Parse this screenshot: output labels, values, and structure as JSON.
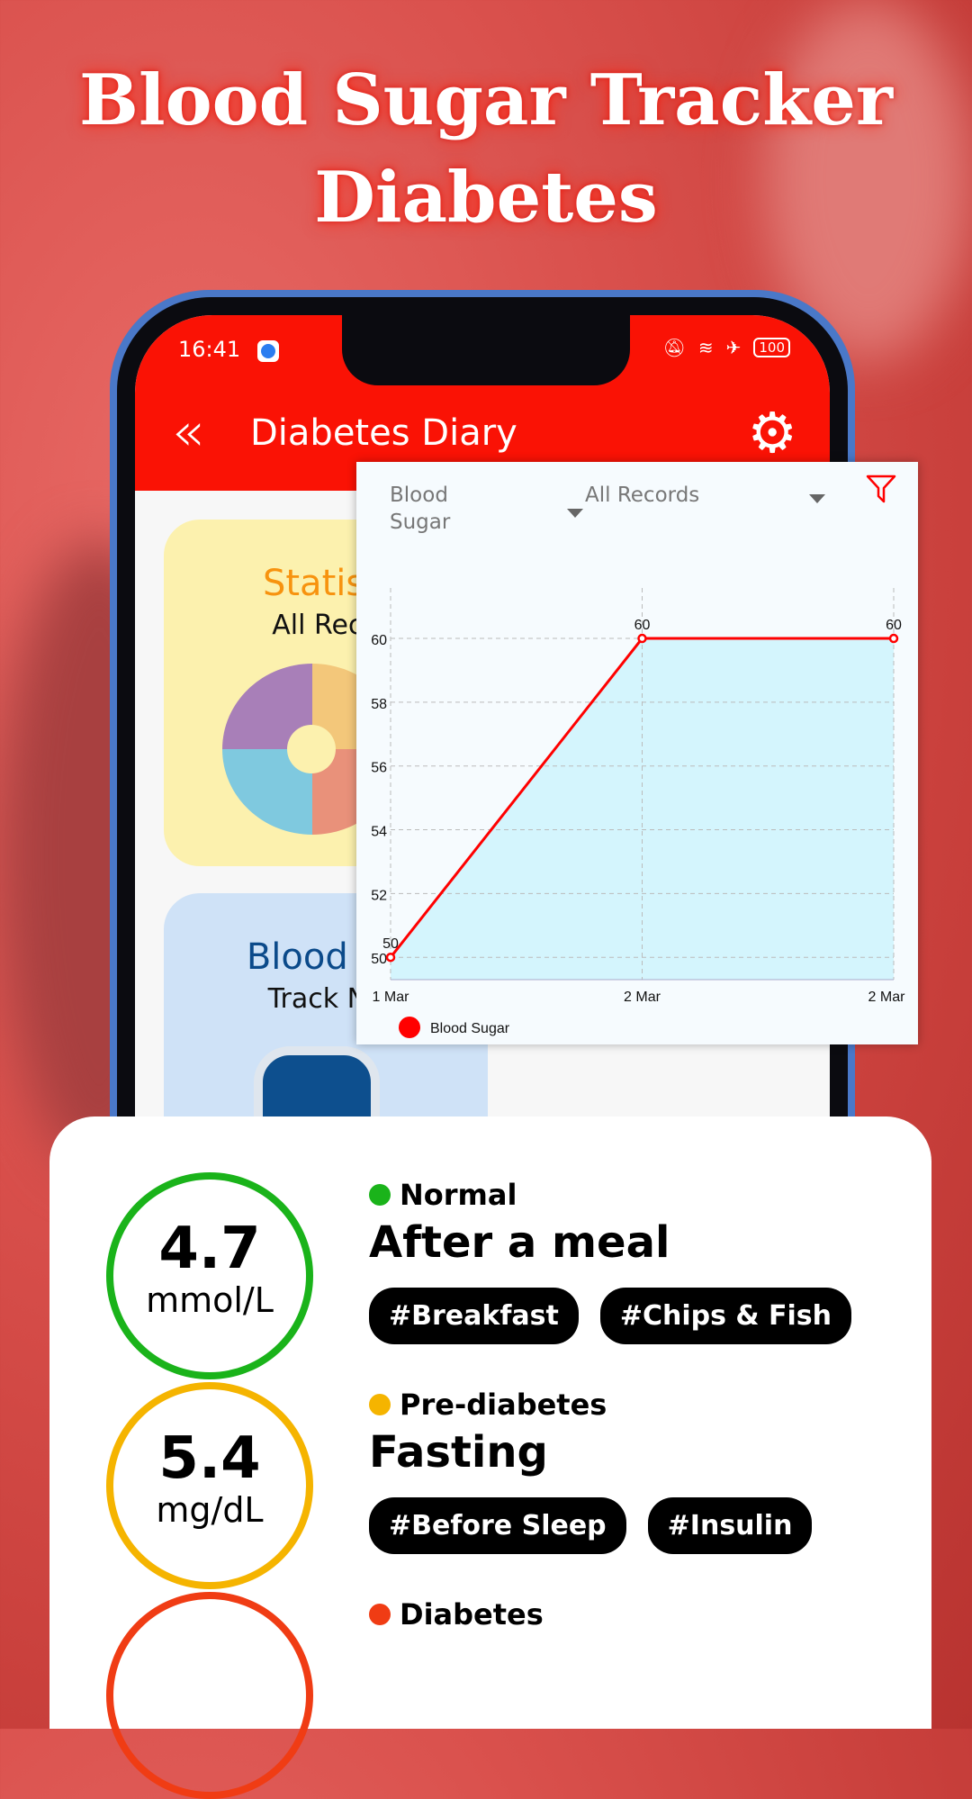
{
  "headline": {
    "line1": "Blood Sugar Tracker",
    "line2": "Diabetes"
  },
  "status_bar": {
    "time": "16:41",
    "battery": "100",
    "icons": [
      "mute-icon",
      "wifi-icon",
      "airplane-icon"
    ]
  },
  "app_bar": {
    "title": "Diabetes Diary",
    "back_icon": "double-chevron-left-icon",
    "settings_icon": "gear-icon"
  },
  "cards": [
    {
      "title": "Statisti",
      "subtitle": "All Reco",
      "title_color": "#f7930f"
    },
    {
      "title": "Blood Su",
      "subtitle": "Track No",
      "title_color": "#0b4a8a"
    }
  ],
  "chart_panel": {
    "type_select": "Blood Sugar",
    "range_select": "All Records",
    "filter_icon": "filter-icon"
  },
  "chart_data": {
    "type": "area",
    "x": [
      "1 Mar",
      "2 Mar",
      "2 Mar"
    ],
    "series": [
      {
        "name": "Blood Sugar",
        "values": [
          50,
          60,
          60
        ],
        "color": "#ff0000",
        "fill": "#d4f5fd"
      }
    ],
    "data_labels": [
      "50",
      "60",
      "60"
    ],
    "yticks": [
      50,
      52,
      54,
      56,
      58,
      60
    ],
    "ylim": [
      49.3,
      61.3
    ],
    "grid": true,
    "legend": "bottom-left"
  },
  "readings": [
    {
      "value": "4.7",
      "unit": "mmol/L",
      "status": "Normal",
      "color": "#1ab31a",
      "meal": "After a meal",
      "tags": [
        "#Breakfast",
        "#Chips & Fish"
      ]
    },
    {
      "value": "5.4",
      "unit": "mg/dL",
      "status": "Pre-diabetes",
      "color": "#f5b400",
      "meal": "Fasting",
      "tags": [
        "#Before Sleep",
        "#Insulin"
      ]
    },
    {
      "value": "",
      "unit": "",
      "status": "Diabetes",
      "color": "#f03c14",
      "meal": "",
      "tags": []
    }
  ]
}
